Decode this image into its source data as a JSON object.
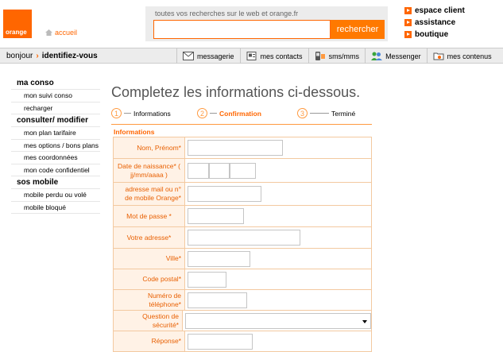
{
  "brand": {
    "logo_text": "orange",
    "home_link": "accueil",
    "accent": "#ff6600"
  },
  "search": {
    "caption": "toutes vos recherches sur le web et orange.fr",
    "value": "",
    "button": "rechercher"
  },
  "top_links": [
    "espace client",
    "assistance",
    "boutique"
  ],
  "navbar": {
    "greeting": "bonjour",
    "separator": "›",
    "identify": "identifiez-vous",
    "items": [
      {
        "label": "messagerie",
        "icon": "envelope-icon"
      },
      {
        "label": "mes contacts",
        "icon": "contacts-icon"
      },
      {
        "label": "sms/mms",
        "icon": "phone-icon"
      },
      {
        "label": "Messenger",
        "icon": "messenger-icon"
      },
      {
        "label": "mes contenus",
        "icon": "contents-icon"
      }
    ]
  },
  "sidebar": {
    "sections": [
      {
        "title": "ma conso",
        "items": [
          "mon suivi conso",
          "recharger"
        ]
      },
      {
        "title": "consulter/ modifier",
        "items": [
          "mon plan tarifaire",
          "mes options / bons plans",
          "mes coordonnées",
          "mon code confidentiel"
        ]
      },
      {
        "title": "sos mobile",
        "items": [
          "mobile perdu ou volé",
          "mobile bloqué"
        ]
      }
    ]
  },
  "main": {
    "title": "Completez les informations ci-dessous.",
    "steps": [
      {
        "num": "1",
        "label": "Informations"
      },
      {
        "num": "2",
        "label": "Confirmation"
      },
      {
        "num": "3",
        "label": "Terminé"
      }
    ],
    "section_title": "Informations",
    "fields": {
      "name": "Nom, Prénom*",
      "birth": "Date de naissance* ( jj/mm/aaaa )",
      "email": "adresse mail ou n° de mobile Orange*",
      "password": "Mot de passe *",
      "address": "Votre adresse*",
      "city": "Ville*",
      "zip": "Code postal*",
      "phone": "Numéro de téléphone*",
      "question": "Question de sécurité*",
      "answer": "Réponse*"
    }
  }
}
